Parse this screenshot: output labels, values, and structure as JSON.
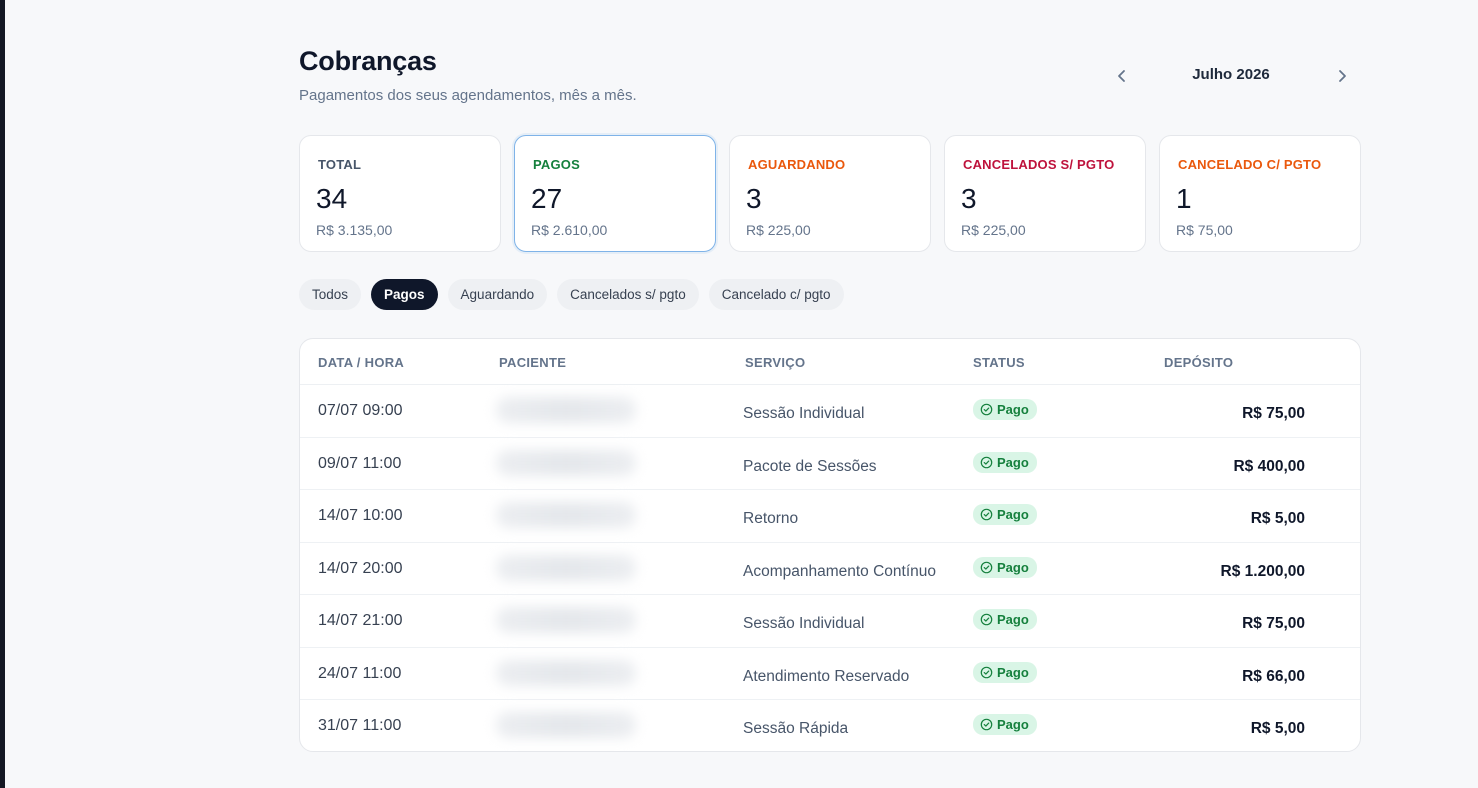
{
  "header": {
    "title": "Cobranças",
    "subtitle": "Pagamentos dos seus agendamentos, mês a mês."
  },
  "month_nav": {
    "label": "Julho 2026",
    "prev_icon": "chevron-left-icon",
    "next_icon": "chevron-right-icon"
  },
  "stats": [
    {
      "label": "TOTAL",
      "count": "34",
      "amount": "R$ 3.135,00",
      "color": "#475569"
    },
    {
      "label": "PAGOS",
      "count": "27",
      "amount": "R$ 2.610,00",
      "color": "#15803d",
      "active": true
    },
    {
      "label": "AGUARDANDO",
      "count": "3",
      "amount": "R$ 225,00",
      "color": "#ea580c"
    },
    {
      "label": "CANCELADOS S/ PGTO",
      "count": "3",
      "amount": "R$ 225,00",
      "color": "#be123c"
    },
    {
      "label": "CANCELADO C/ PGTO",
      "count": "1",
      "amount": "R$ 75,00",
      "color": "#ea580c"
    }
  ],
  "filters": [
    {
      "label": "Todos"
    },
    {
      "label": "Pagos",
      "active": true
    },
    {
      "label": "Aguardando"
    },
    {
      "label": "Cancelados s/ pgto"
    },
    {
      "label": "Cancelado c/ pgto"
    }
  ],
  "table": {
    "columns": [
      "DATA / HORA",
      "PACIENTE",
      "SERVIÇO",
      "STATUS",
      "DEPÓSITO"
    ],
    "rows": [
      {
        "datetime": "07/07 09:00",
        "service": "Sessão Individual",
        "status": "Pago",
        "deposit": "R$ 75,00"
      },
      {
        "datetime": "09/07 11:00",
        "service": "Pacote de Sessões",
        "status": "Pago",
        "deposit": "R$ 400,00"
      },
      {
        "datetime": "14/07 10:00",
        "service": "Retorno",
        "status": "Pago",
        "deposit": "R$ 5,00"
      },
      {
        "datetime": "14/07 20:00",
        "service": "Acompanhamento Contínuo",
        "status": "Pago",
        "deposit": "R$ 1.200,00"
      },
      {
        "datetime": "14/07 21:00",
        "service": "Sessão Individual",
        "status": "Pago",
        "deposit": "R$ 75,00"
      },
      {
        "datetime": "24/07 11:00",
        "service": "Atendimento Reservado",
        "status": "Pago",
        "deposit": "R$ 66,00"
      },
      {
        "datetime": "31/07 11:00",
        "service": "Sessão Rápida",
        "status": "Pago",
        "deposit": "R$ 5,00"
      }
    ]
  },
  "colors": {
    "status_paid_bg": "#d9f5e6",
    "status_paid_text": "#15803d",
    "active_chip": "#0f172a",
    "active_card_border": "#7fb3e8"
  }
}
